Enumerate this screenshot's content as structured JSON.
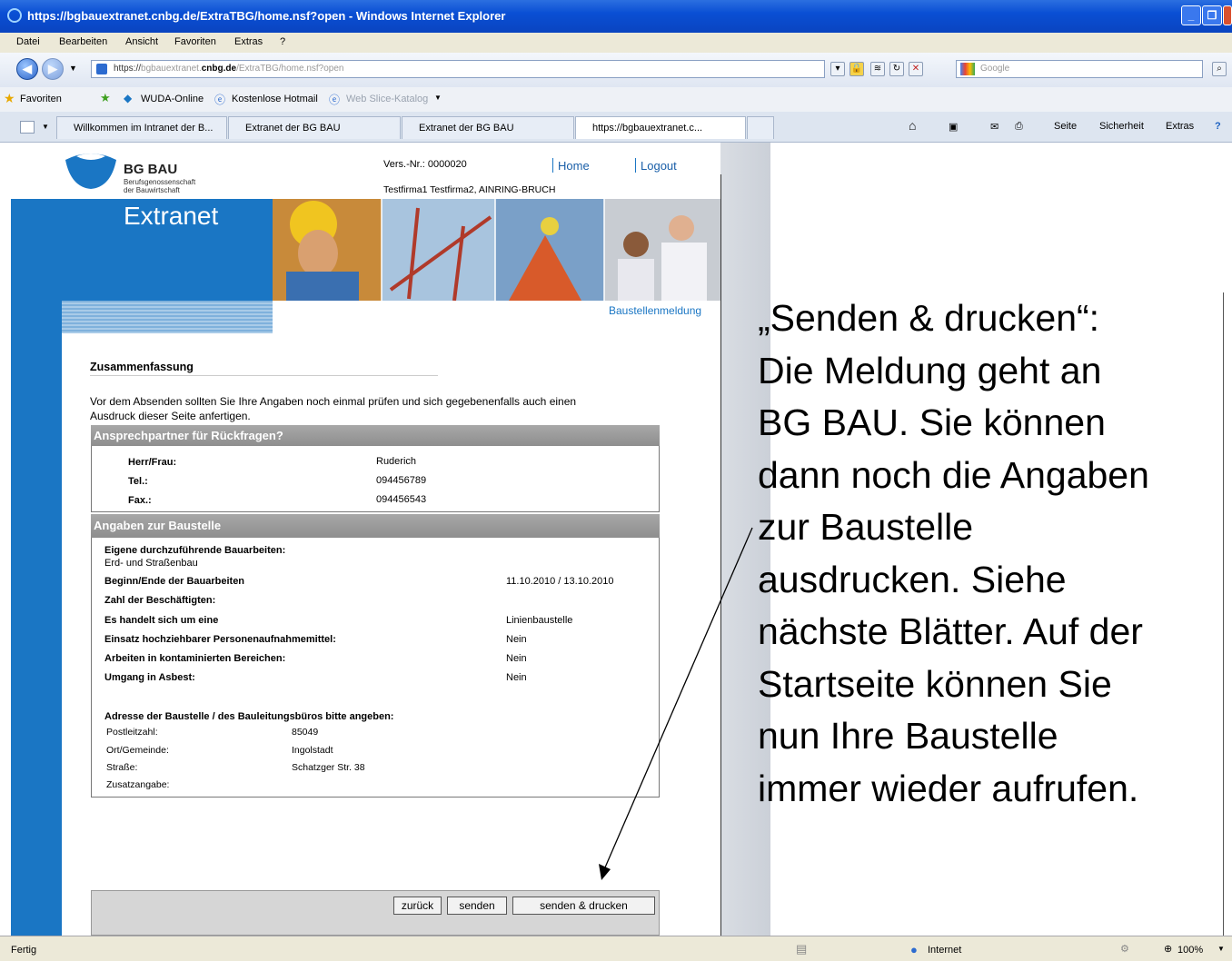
{
  "window": {
    "title": "https://bgbauextranet.cnbg.de/ExtraTBG/home.nsf?open - Windows Internet Explorer"
  },
  "menu": {
    "items": [
      "Datei",
      "Bearbeiten",
      "Ansicht",
      "Favoriten",
      "Extras",
      "?"
    ]
  },
  "address": {
    "url_prefix": "https://",
    "url_host_dim": "bgbauextranet.",
    "url_host": "cnbg.de",
    "url_path": "/ExtraTBG/home.nsf?open",
    "search_placeholder": "Google"
  },
  "favorites": {
    "label": "Favoriten",
    "items": [
      "WUDA-Online",
      "Kostenlose Hotmail",
      "Web Slice-Katalog"
    ]
  },
  "tabs": [
    "Willkommen im Intranet der B...",
    "Extranet der BG BAU",
    "Extranet der BG BAU",
    "https://bgbauextranet.c..."
  ],
  "commandbar": {
    "seite": "Seite",
    "sicherheit": "Sicherheit",
    "extras": "Extras"
  },
  "page": {
    "logo_title": "BG BAU",
    "logo_sub1": "Berufsgenossenschaft",
    "logo_sub2": "der Bauwirtschaft",
    "extranet": "Extranet",
    "vers_nr": "Vers.-Nr.: 0000020",
    "home_link": "Home",
    "logout_link": "Logout",
    "company": "Testfirma1 Testfirma2, AINRING-BRUCH",
    "nav_link": "Baustellenmeldung",
    "summary_title": "Zusammenfassung",
    "intro_line1": "Vor dem Absenden sollten Sie Ihre Angaben noch einmal prüfen und sich gegebenenfalls auch einen",
    "intro_line2": "Ausdruck dieser Seite anfertigen.",
    "contact_header": "Ansprechpartner für Rückfragen?",
    "contact": [
      {
        "label": "Herr/Frau:",
        "value": "Ruderich"
      },
      {
        "label": "Tel.:",
        "value": "094456789"
      },
      {
        "label": "Fax.:",
        "value": "094456543"
      }
    ],
    "site_header": "Angaben zur Baustelle",
    "own_work_label": "Eigene durchzuführende Bauarbeiten:",
    "own_work_value": "Erd- und Straßenbau",
    "site_rows": [
      {
        "label": "Beginn/Ende der Bauarbeiten",
        "value": "11.10.2010 / 13.10.2010"
      },
      {
        "label": "Zahl der Beschäftigten:",
        "value": ""
      },
      {
        "label": "Es handelt sich um eine",
        "value": "Linienbaustelle"
      },
      {
        "label": "Einsatz hochziehbarer Personenaufnahmemittel:",
        "value": "Nein"
      },
      {
        "label": "Arbeiten in kontaminierten Bereichen:",
        "value": "Nein"
      },
      {
        "label": "Umgang in Asbest:",
        "value": "Nein"
      }
    ],
    "address_header": "Adresse der Baustelle / des Bauleitungsbüros bitte angeben:",
    "address_rows": [
      {
        "label": "Postleitzahl:",
        "value": "85049"
      },
      {
        "label": "Ort/Gemeinde:",
        "value": "Ingolstadt"
      },
      {
        "label": "Straße:",
        "value": "Schatzger Str. 38"
      },
      {
        "label": "Zusatzangabe:",
        "value": ""
      }
    ],
    "btn_back": "zurück",
    "btn_send": "senden",
    "btn_send_print": "senden & drucken"
  },
  "status": {
    "left": "Fertig",
    "zone": "Internet",
    "zoom": "100%"
  },
  "annotation": {
    "lines": [
      "„Senden & drucken“:",
      "Die Meldung geht an",
      "BG BAU. Sie können",
      "dann noch die Angaben",
      "zur Baustelle",
      "ausdrucken. Siehe",
      "nächste Blätter. Auf der",
      "Startseite können Sie",
      "nun Ihre Baustelle",
      "immer wieder aufrufen."
    ]
  },
  "colors": {
    "brand_blue": "#1a76c4",
    "titlebar": "#0a4fd4",
    "section_gray": "#999999"
  }
}
